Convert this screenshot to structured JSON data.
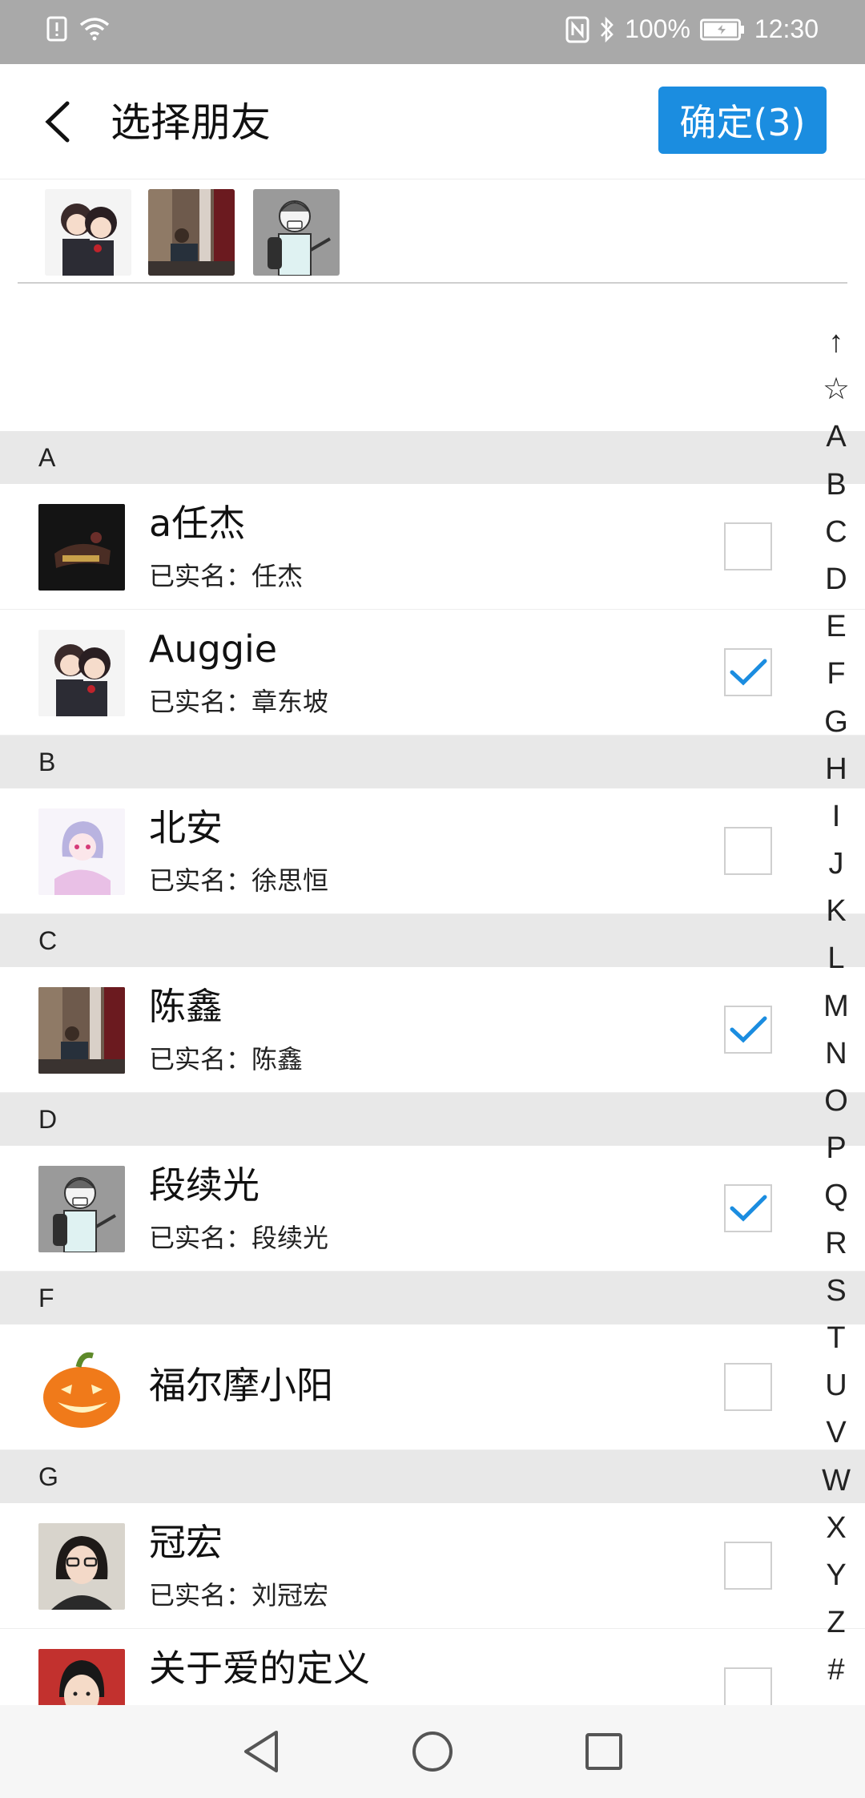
{
  "status_bar": {
    "battery": "100%",
    "time": "12:30",
    "icons": [
      "alert-icon",
      "wifi-icon",
      "nfc-icon",
      "bluetooth-icon",
      "battery-icon"
    ]
  },
  "header": {
    "back_icon": "back-arrow-icon",
    "title": "选择朋友",
    "confirm_label": "确定(3)",
    "confirm_color": "#1b8de0"
  },
  "selected": {
    "avatars": [
      "anime-couple-avatar",
      "photo-man-avatar",
      "cartoon-man-avatar"
    ]
  },
  "sections": [
    {
      "letter": "A",
      "contacts": [
        {
          "name": "a任杰",
          "real_name": "已实名：任杰",
          "checked": false,
          "avatar": "dark-hand-avatar"
        },
        {
          "name": "Auggie",
          "real_name": "已实名：章东坡",
          "checked": true,
          "avatar": "anime-couple-avatar"
        }
      ]
    },
    {
      "letter": "B",
      "contacts": [
        {
          "name": "北安",
          "real_name": "已实名：徐思恒",
          "checked": false,
          "avatar": "anime-girl-avatar"
        }
      ]
    },
    {
      "letter": "C",
      "contacts": [
        {
          "name": "陈鑫",
          "real_name": "已实名：陈鑫",
          "checked": true,
          "avatar": "photo-man-avatar"
        }
      ]
    },
    {
      "letter": "D",
      "contacts": [
        {
          "name": "段续光",
          "real_name": "已实名：段续光",
          "checked": true,
          "avatar": "cartoon-man-avatar"
        }
      ]
    },
    {
      "letter": "F",
      "contacts": [
        {
          "name": "福尔摩小阳",
          "real_name": "",
          "checked": false,
          "avatar": "pumpkin-avatar"
        }
      ]
    },
    {
      "letter": "G",
      "contacts": [
        {
          "name": "冠宏",
          "real_name": "已实名：刘冠宏",
          "checked": false,
          "avatar": "woman-glasses-avatar"
        },
        {
          "name": "关于爱的定义",
          "real_name": "",
          "checked": false,
          "avatar": "young-man-avatar"
        }
      ]
    }
  ],
  "index": [
    "↑",
    "☆",
    "A",
    "B",
    "C",
    "D",
    "E",
    "F",
    "G",
    "H",
    "I",
    "J",
    "K",
    "L",
    "M",
    "N",
    "O",
    "P",
    "Q",
    "R",
    "S",
    "T",
    "U",
    "V",
    "W",
    "X",
    "Y",
    "Z",
    "#"
  ],
  "navbar": {
    "icons": [
      "nav-back-icon",
      "nav-home-icon",
      "nav-recents-icon"
    ]
  },
  "colors": {
    "accent": "#1b8de0",
    "section_bg": "#e8e8e8",
    "statusbar_bg": "#a9a9a9"
  }
}
